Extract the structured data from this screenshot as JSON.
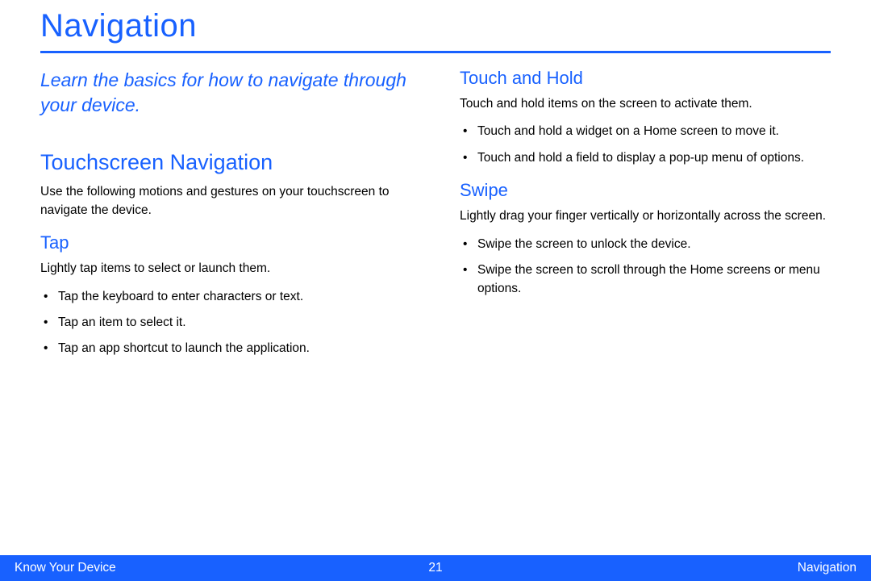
{
  "page_title": "Navigation",
  "left_column": {
    "intro": "Learn the basics for how to navigate through your device.",
    "section_heading": "Touchscreen Navigation",
    "section_intro": "Use the following motions and gestures on your touchscreen to navigate the device.",
    "tap": {
      "heading": "Tap",
      "intro": "Lightly tap items to select or launch them.",
      "bullets": [
        "Tap the keyboard to enter characters or text.",
        "Tap an item to select it.",
        "Tap an app shortcut to launch the application."
      ]
    }
  },
  "right_column": {
    "touch_hold": {
      "heading": "Touch and Hold",
      "intro": "Touch and hold items on the screen to activate them.",
      "bullets": [
        "Touch and hold a widget on a Home screen to move it.",
        "Touch and hold a field to display a pop-up menu of options."
      ]
    },
    "swipe": {
      "heading": "Swipe",
      "intro": "Lightly drag your finger vertically or horizontally across the screen.",
      "bullets": [
        "Swipe the screen to unlock the device.",
        "Swipe the screen to scroll through the Home screens or menu options."
      ]
    }
  },
  "footer": {
    "left": "Know Your Device",
    "center": "21",
    "right": "Navigation"
  }
}
